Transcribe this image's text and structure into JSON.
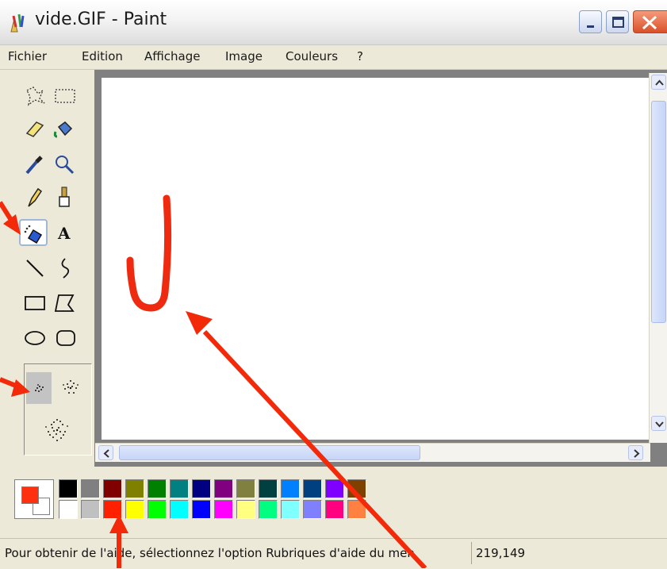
{
  "window": {
    "title": "vide.GIF - Paint"
  },
  "menu": {
    "items": [
      "Fichier",
      "Edition",
      "Affichage",
      "Image",
      "Couleurs",
      "?"
    ]
  },
  "toolbox": {
    "tools": [
      "free-select-icon",
      "rect-select-icon",
      "eraser-icon",
      "fill-bucket-icon",
      "color-picker-icon",
      "magnifier-icon",
      "pencil-icon",
      "brush-icon",
      "airbrush-icon",
      "text-icon",
      "line-icon",
      "curve-icon",
      "rectangle-icon",
      "polygon-icon",
      "ellipse-icon",
      "rounded-rect-icon"
    ],
    "active_tool": "airbrush-icon",
    "text_tool_label": "A",
    "spray_sizes": [
      "small",
      "medium",
      "large"
    ],
    "active_spray_size": "small"
  },
  "canvas": {
    "stroke_color": "#ee2a10"
  },
  "palette": {
    "foreground": "#ff3010",
    "background": "#ffffff",
    "top_row": [
      "#000000",
      "#808080",
      "#800000",
      "#808000",
      "#008000",
      "#008080",
      "#000080",
      "#800080",
      "#808040",
      "#004040",
      "#0080ff",
      "#004080",
      "#8000ff",
      "#804000"
    ],
    "bottom_row": [
      "#ffffff",
      "#c0c0c0",
      "#ff2000",
      "#ffff00",
      "#00ff00",
      "#00ffff",
      "#0000ff",
      "#ff00ff",
      "#ffff80",
      "#00ff80",
      "#80ffff",
      "#8080ff",
      "#ff0080",
      "#ff8040"
    ]
  },
  "status": {
    "help_text": "Pour obtenir de l'aide, sélectionnez l'option Rubriques d'aide du men",
    "coordinates": "219,149"
  },
  "annotation": {
    "arrow_color": "#f22a0a"
  }
}
